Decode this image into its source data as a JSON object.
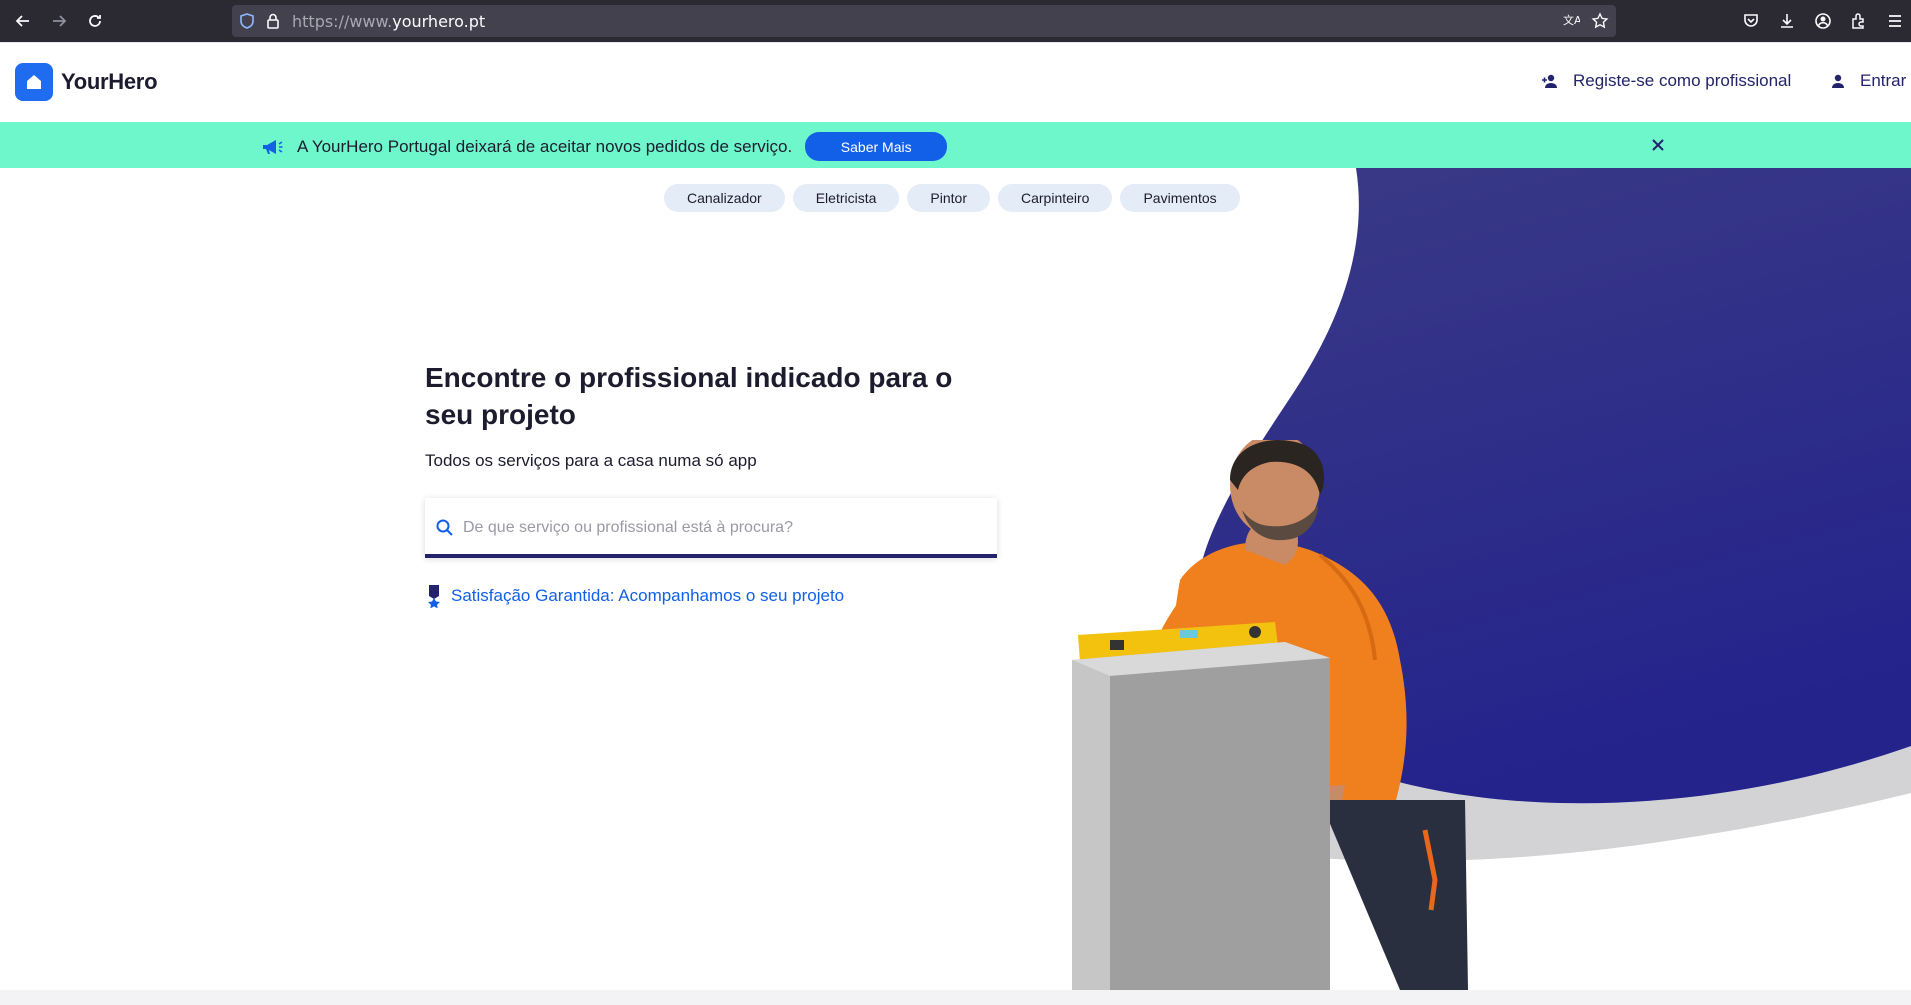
{
  "browser": {
    "url_prefix": "https://www.",
    "url_domain": "yourhero.pt"
  },
  "header": {
    "logo_text": "YourHero",
    "register_label": "Registe-se como profissional",
    "login_label": "Entrar"
  },
  "banner": {
    "message": "A YourHero Portugal deixará de aceitar novos pedidos de serviço.",
    "button_label": "Saber Mais"
  },
  "categories": [
    "Canalizador",
    "Eletricista",
    "Pintor",
    "Carpinteiro",
    "Pavimentos"
  ],
  "hero": {
    "title": "Encontre o profissional indicado para o seu projeto",
    "subtitle": "Todos os serviços para a casa numa só app",
    "search_placeholder": "De que serviço ou profissional está à procura?",
    "guarantee": "Satisfação Garantida: Acompanhamos o seu projeto"
  },
  "colors": {
    "brand_blue": "#1260e8",
    "navy": "#23236b",
    "banner_bg": "#6ff7cc",
    "chip_bg": "#e4ecf7"
  }
}
